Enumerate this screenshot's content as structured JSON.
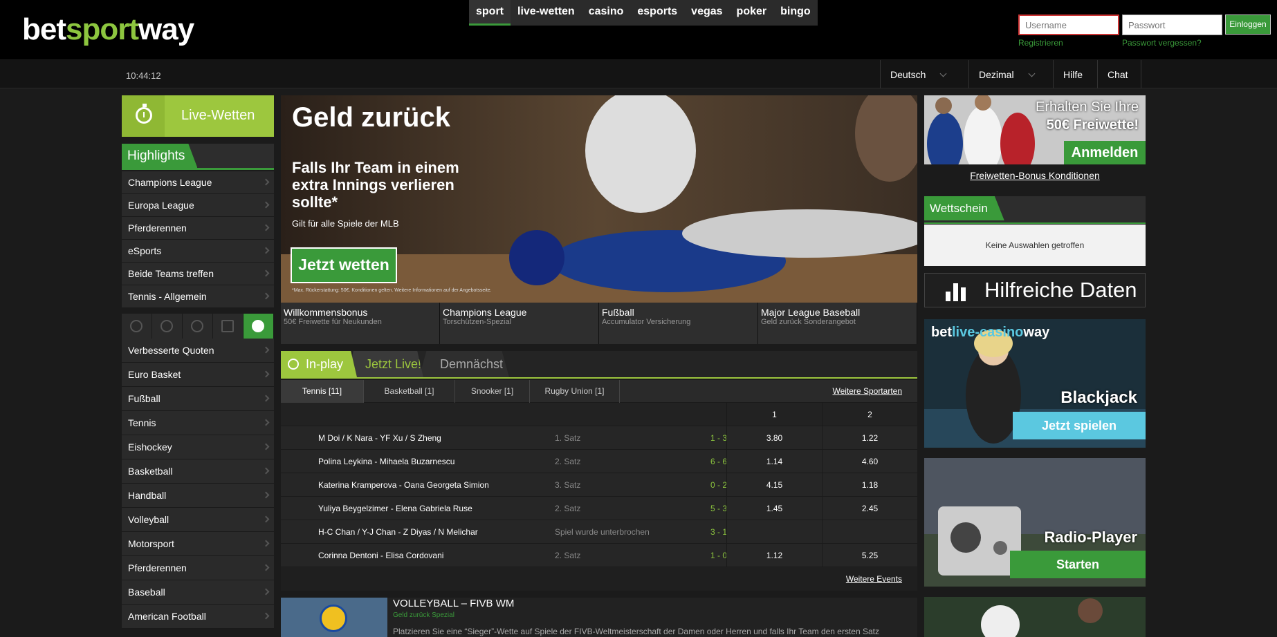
{
  "header": {
    "logo_prefix": "bet",
    "logo_mid": "sport",
    "logo_suffix": "way",
    "nav": [
      "sport",
      "live-wetten",
      "casino",
      "esports",
      "vegas",
      "poker",
      "bingo"
    ],
    "active_nav": "sport",
    "login": {
      "username_placeholder": "Username",
      "password_placeholder": "Passwort",
      "login_label": "Einloggen",
      "register_label": "Registrieren",
      "forgot_label": "Passwort vergessen?"
    }
  },
  "subbar": {
    "time": "10:44:12",
    "language": "Deutsch",
    "odds_format": "Dezimal",
    "help": "Hilfe",
    "chat": "Chat"
  },
  "left": {
    "live_button": "Live-Wetten",
    "highlights_title": "Highlights",
    "highlights": [
      "Champions League",
      "Europa League",
      "Pferderennen",
      "eSports",
      "Beide Teams treffen",
      "Tennis - Allgemein"
    ],
    "filter_icons": [
      "stopwatch-icon",
      "moon-half-icon",
      "moon-icon",
      "calendar-icon",
      "circle-icon"
    ],
    "sports": [
      "Verbesserte Quoten",
      "Euro Basket",
      "Fußball",
      "Tennis",
      "Eishockey",
      "Basketball",
      "Handball",
      "Volleyball",
      "Motorsport",
      "Pferderennen",
      "Baseball",
      "American Football"
    ]
  },
  "banner": {
    "title": "Geld zurück",
    "subtitle": "Falls Ihr Team in einem extra Innings verlieren sollte*",
    "note": "Gilt für alle Spiele der MLB",
    "cta": "Jetzt wetten",
    "fineprint": "*Max. Rückerstattung: 50€. Konditionen gelten. Weitere Informationen auf der Angebotsseite."
  },
  "promos": [
    {
      "title": "Willkommensbonus",
      "sub": "50€ Freiwette für Neukunden"
    },
    {
      "title": "Champions League",
      "sub": "Torschützen-Spezial"
    },
    {
      "title": "Fußball",
      "sub": "Accumulator Versicherung"
    },
    {
      "title": "Major League Baseball",
      "sub": "Geld zurück Sonderangebot"
    }
  ],
  "inplay": {
    "tabs": [
      "In-play",
      "Jetzt Live!",
      "Demnächst"
    ],
    "sport_tabs": [
      "Tennis [11]",
      "Basketball [1]",
      "Snooker [1]",
      "Rugby Union [1]"
    ],
    "more_sports": "Weitere Sportarten",
    "col1": "1",
    "col2": "2",
    "rows": [
      {
        "event": "M Doi / K Nara - YF Xu / S Zheng",
        "status": "1. Satz",
        "score": "1 - 3",
        "o1": "3.80",
        "o2": "1.22"
      },
      {
        "event": "Polina Leykina - Mihaela Buzarnescu",
        "status": "2. Satz",
        "score": "6 - 6",
        "o1": "1.14",
        "o2": "4.60"
      },
      {
        "event": "Katerina Kramperova - Oana Georgeta Simion",
        "status": "3. Satz",
        "score": "0 - 2",
        "o1": "4.15",
        "o2": "1.18"
      },
      {
        "event": "Yuliya Beygelzimer - Elena Gabriela Ruse",
        "status": "2. Satz",
        "score": "5 - 3",
        "o1": "1.45",
        "o2": "2.45"
      },
      {
        "event": "H-C Chan / Y-J Chan - Z Diyas / N Melichar",
        "status": "Spiel wurde unterbrochen",
        "score": "3 - 1",
        "o1": "",
        "o2": ""
      },
      {
        "event": "Corinna Dentoni - Elisa Cordovani",
        "status": "2. Satz",
        "score": "1 - 0",
        "o1": "1.12",
        "o2": "5.25"
      }
    ],
    "more_events": "Weitere Events"
  },
  "volleyball": {
    "title": "VOLLEYBALL – FIVB WM",
    "sub": "Geld zurück Spezial",
    "text": "Platzieren Sie eine “Sieger”-Wette auf Spiele der FIVB-Weltmeisterschaft der Damen oder Herren und falls Ihr Team den ersten Satz"
  },
  "right": {
    "freebet_line1": "Erhalten Sie Ihre",
    "freebet_line2": "50€ Freiwette!",
    "freebet_cta": "Anmelden",
    "freebet_link": "Freiwetten-Bonus Konditionen",
    "betslip_title": "Wettschein",
    "betslip_empty": "Keine Auswahlen getroffen",
    "helpful_data": "Hilfreiche Daten",
    "casino_logo_prefix": "bet",
    "casino_logo_mid": "live-casino",
    "casino_logo_suffix": "way",
    "casino_title": "Blackjack",
    "casino_cta": "Jetzt spielen",
    "radio_title": "Radio-Player",
    "radio_cta": "Starten"
  },
  "colors": {
    "brand_green": "#3a9a3a",
    "lime": "#9dc73e",
    "accent_blue": "#5bc8e0"
  }
}
